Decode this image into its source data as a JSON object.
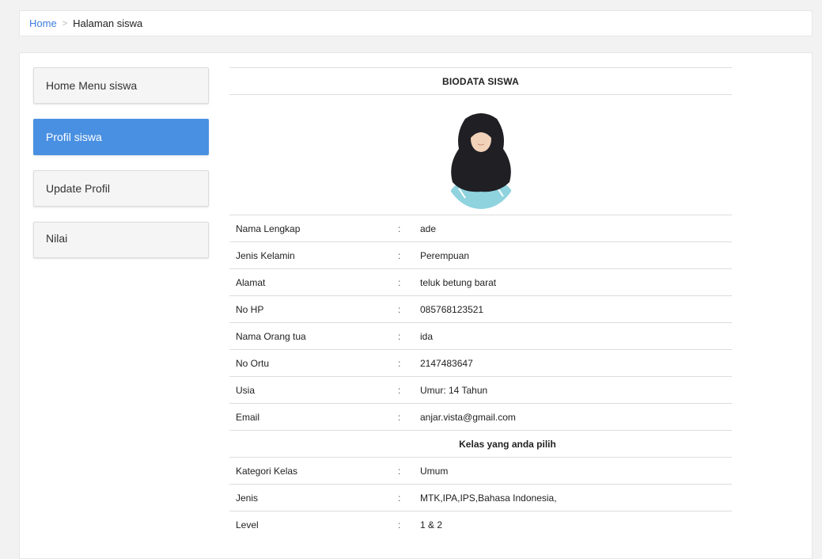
{
  "breadcrumb": {
    "home": "Home",
    "separator": ">",
    "current": "Halaman siswa"
  },
  "menu": {
    "items": [
      {
        "label": "Home Menu siswa",
        "active": false
      },
      {
        "label": "Profil siswa",
        "active": true
      },
      {
        "label": "Update Profil",
        "active": false
      },
      {
        "label": "Nilai",
        "active": false
      }
    ]
  },
  "biodata": {
    "title": "BIODATA SISWA",
    "photo_icon": "student-photo",
    "rows": [
      {
        "label": "Nama Lengkap",
        "colon": ":",
        "value": "ade"
      },
      {
        "label": "Jenis Kelamin",
        "colon": ":",
        "value": "Perempuan"
      },
      {
        "label": "Alamat",
        "colon": ":",
        "value": "teluk betung barat"
      },
      {
        "label": "No HP",
        "colon": ":",
        "value": "085768123521"
      },
      {
        "label": "Nama Orang tua",
        "colon": ":",
        "value": "ida"
      },
      {
        "label": "No Ortu",
        "colon": ":",
        "value": "2147483647"
      },
      {
        "label": "Usia",
        "colon": ":",
        "value": "Umur: 14 Tahun"
      },
      {
        "label": "Email",
        "colon": ":",
        "value": "anjar.vista@gmail.com"
      }
    ],
    "section_title": "Kelas yang anda pilih",
    "class_rows": [
      {
        "label": "Kategori Kelas",
        "colon": ":",
        "value": "Umum"
      },
      {
        "label": "Jenis",
        "colon": ":",
        "value": "MTK,IPA,IPS,Bahasa Indonesia,"
      },
      {
        "label": "Level",
        "colon": ":",
        "value": "1 & 2"
      }
    ]
  },
  "colors": {
    "accent": "#4a90e2",
    "link": "#3b7ddd",
    "background": "#f2f2f2"
  }
}
